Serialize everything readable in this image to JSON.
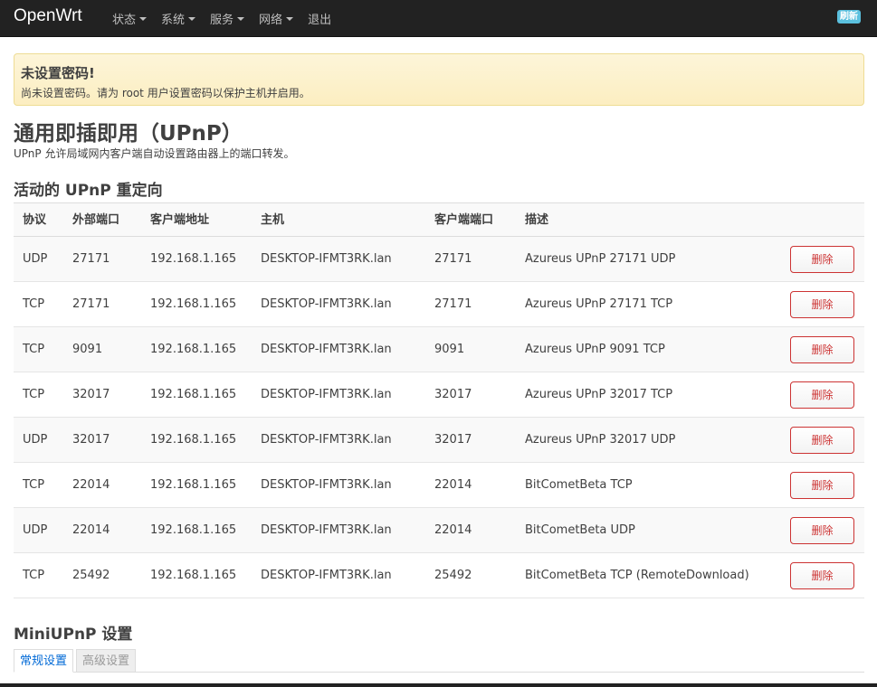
{
  "nav": {
    "brand": "OpenWrt",
    "menu": [
      "状态",
      "系统",
      "服务",
      "网络",
      "退出"
    ],
    "refresh": "刷新"
  },
  "alert": {
    "title": "未设置密码!",
    "text": "尚未设置密码。请为 root 用户设置密码以保护主机并启用。"
  },
  "page": {
    "title": "通用即插即用（UPnP）",
    "description": "UPnP 允许局域网内客户端自动设置路由器上的端口转发。",
    "section_title": "活动的 UPnP 重定向"
  },
  "table": {
    "headers": [
      "协议",
      "外部端口",
      "客户端地址",
      "主机",
      "客户端端口",
      "描述"
    ],
    "delete_label": "删除",
    "rows": [
      [
        "UDP",
        "27171",
        "192.168.1.165",
        "DESKTOP-IFMT3RK.lan",
        "27171",
        "Azureus UPnP 27171 UDP"
      ],
      [
        "TCP",
        "27171",
        "192.168.1.165",
        "DESKTOP-IFMT3RK.lan",
        "27171",
        "Azureus UPnP 27171 TCP"
      ],
      [
        "TCP",
        "9091",
        "192.168.1.165",
        "DESKTOP-IFMT3RK.lan",
        "9091",
        "Azureus UPnP 9091 TCP"
      ],
      [
        "TCP",
        "32017",
        "192.168.1.165",
        "DESKTOP-IFMT3RK.lan",
        "32017",
        "Azureus UPnP 32017 TCP"
      ],
      [
        "UDP",
        "32017",
        "192.168.1.165",
        "DESKTOP-IFMT3RK.lan",
        "32017",
        "Azureus UPnP 32017 UDP"
      ],
      [
        "TCP",
        "22014",
        "192.168.1.165",
        "DESKTOP-IFMT3RK.lan",
        "22014",
        "BitCometBeta TCP"
      ],
      [
        "UDP",
        "22014",
        "192.168.1.165",
        "DESKTOP-IFMT3RK.lan",
        "22014",
        "BitCometBeta UDP"
      ],
      [
        "TCP",
        "25492",
        "192.168.1.165",
        "DESKTOP-IFMT3RK.lan",
        "25492",
        "BitCometBeta TCP (RemoteDownload)"
      ]
    ]
  },
  "settings": {
    "title": "MiniUPnP 设置",
    "tabs": [
      "常规设置",
      "高级设置"
    ]
  }
}
